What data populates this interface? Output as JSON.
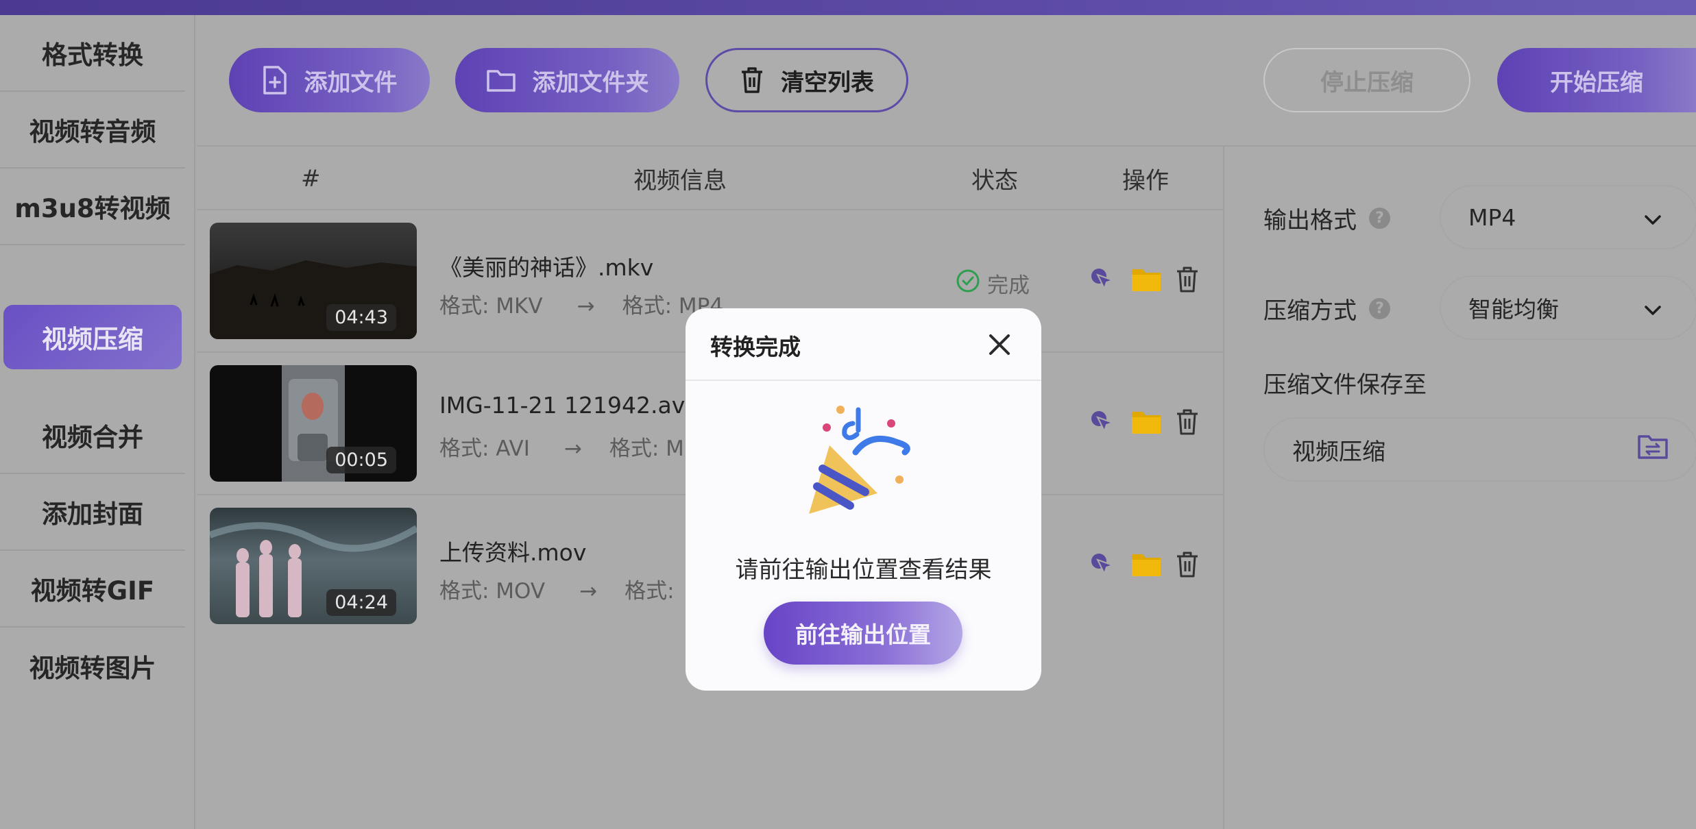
{
  "sidebar": {
    "items": [
      {
        "label": "格式转换"
      },
      {
        "label": "视频转音频"
      },
      {
        "label": "m3u8转视频"
      },
      {
        "label": "视频压缩"
      },
      {
        "label": "视频合并"
      },
      {
        "label": "添加封面"
      },
      {
        "label": "视频转GIF"
      },
      {
        "label": "视频转图片"
      }
    ],
    "active": "视频压缩"
  },
  "toolbar": {
    "add_file_label": "添加文件",
    "add_folder_label": "添加文件夹",
    "clear_list_label": "清空列表",
    "stop_label": "停止压缩",
    "start_label": "开始压缩"
  },
  "table": {
    "headers": {
      "index": "#",
      "info": "视频信息",
      "status": "状态",
      "actions": "操作"
    },
    "rows": [
      {
        "name": "《美丽的神话》.mkv",
        "duration": "04:43",
        "src_format": "格式: MKV",
        "arrow": "→",
        "dst_format": "格式: MP4",
        "status": "完成"
      },
      {
        "name": "IMG-11-21 121942.avi",
        "duration": "00:05",
        "src_format": "格式: AVI",
        "arrow": "→",
        "dst_format": "格式: M"
      },
      {
        "name": "上传资料.mov",
        "duration": "04:24",
        "src_format": "格式: MOV",
        "arrow": "→",
        "dst_format": "格式:"
      }
    ]
  },
  "settings": {
    "output_format_label": "输出格式",
    "output_format_value": "MP4",
    "compress_mode_label": "压缩方式",
    "compress_mode_value": "智能均衡",
    "save_to_label": "压缩文件保存至",
    "save_path": "视频压缩"
  },
  "dialog": {
    "title": "转换完成",
    "message": "请前往输出位置查看结果",
    "button_label": "前往输出位置"
  },
  "colors": {
    "accent": "#6a50c4",
    "folder": "#e0a800",
    "status_done": "#2e9e4f"
  }
}
